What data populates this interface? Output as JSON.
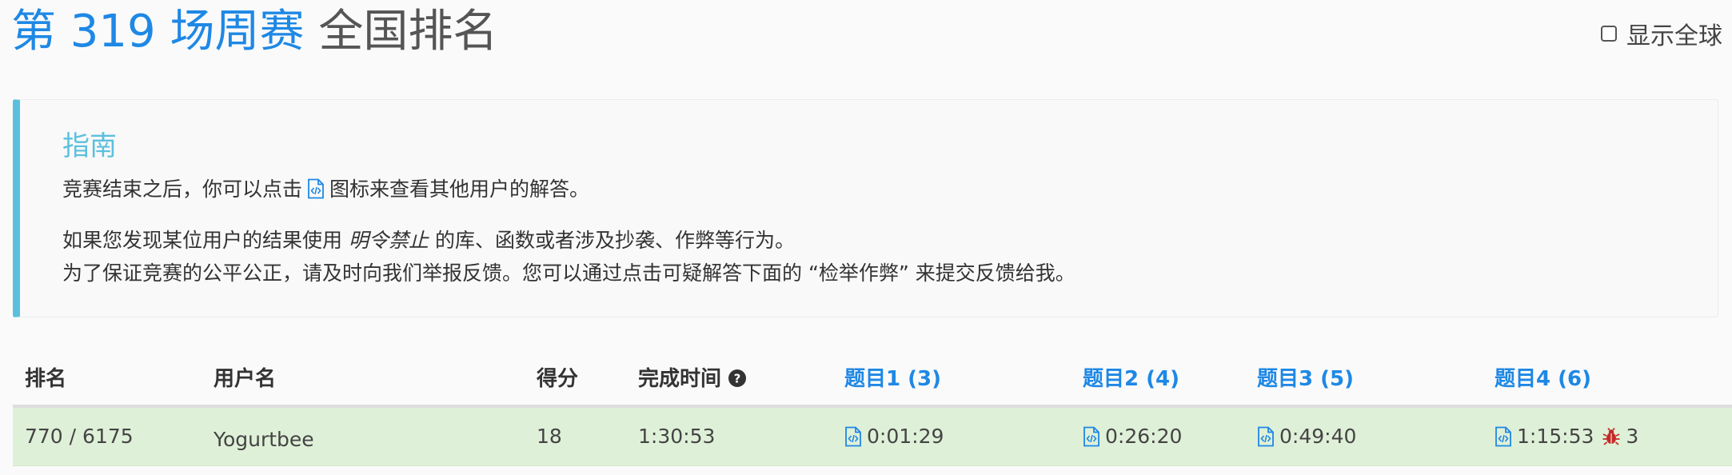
{
  "header": {
    "title_contest": "第 319 场周赛",
    "title_ranking": "全国排名",
    "show_global_label": "显示全球"
  },
  "guide": {
    "title": "指南",
    "line1_before": "竞赛结束之后，你可以点击",
    "line1_after": "图标来查看其他用户的解答。",
    "line2_before": "如果您发现某位用户的结果使用",
    "line2_emphasis": "明令禁止",
    "line2_after": "的库、函数或者涉及抄袭、作弊等行为。",
    "line3": "为了保证竞赛的公平公正，请及时向我们举报反馈。您可以通过点击可疑解答下面的 “检举作弊” 来提交反馈给我。"
  },
  "table": {
    "headers": {
      "rank": "排名",
      "username": "用户名",
      "score": "得分",
      "finish_time": "完成时间",
      "q1": "题目1 (3)",
      "q2": "题目2 (4)",
      "q3": "题目3 (5)",
      "q4": "题目4 (6)"
    },
    "rows": [
      {
        "rank": "770 / 6175",
        "username": "Yogurtbee",
        "score": "18",
        "finish_time": "1:30:53",
        "q1_time": "0:01:29",
        "q2_time": "0:26:20",
        "q3_time": "0:49:40",
        "q4_time": "1:15:53",
        "q4_wrong": "3"
      }
    ]
  },
  "colors": {
    "primary_blue": "#1e88e5",
    "guide_accent": "#5bc0de",
    "row_success": "#dff0d8",
    "bug_red": "#c62828"
  },
  "icons": {
    "code": "code-file-icon",
    "help": "question-circle-icon",
    "bug": "bug-icon",
    "checkbox": "checkbox-icon"
  }
}
